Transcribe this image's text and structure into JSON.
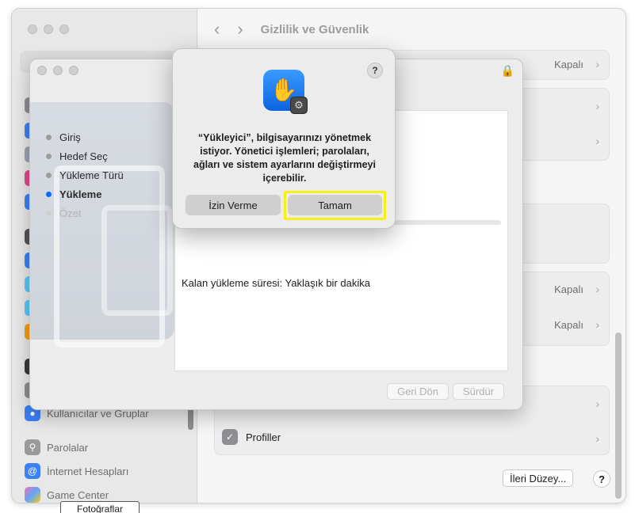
{
  "settings": {
    "title": "Gizlilik ve Güvenlik",
    "rows": [
      {
        "status": "Kapalı"
      },
      {
        "status": "Kapalı"
      },
      {
        "status": "Kapalı"
      }
    ],
    "profiles_label": "Profiller",
    "advanced_button": "İleri Düzey...",
    "help": "?"
  },
  "sidebar": {
    "items": [
      {
        "label": "Kullanıcılar ve Gruplar",
        "icon": "users-icon"
      },
      {
        "label": "Parolalar",
        "icon": "key-icon"
      },
      {
        "label": "İnternet Hesapları",
        "icon": "at-icon"
      },
      {
        "label": "Game Center",
        "icon": "game-center-icon"
      }
    ],
    "tooltip": "Fotoğraflar"
  },
  "installer": {
    "steps": [
      {
        "label": "Giriş",
        "state": "done"
      },
      {
        "label": "Hedef Seç",
        "state": "done"
      },
      {
        "label": "Yükleme Türü",
        "state": "done"
      },
      {
        "label": "Yükleme",
        "state": "active"
      },
      {
        "label": "Özet",
        "state": "disabled"
      }
    ],
    "remaining": "Kalan yükleme süresi: Yaklaşık bir dakika",
    "back_button": "Geri Dön",
    "continue_button": "Sürdür"
  },
  "alert": {
    "message": "“Yükleyici”, bilgisayarınızı yönetmek istiyor. Yönetici işlemleri; parolaları, ağları ve sistem ayarlarını değiştirmeyi içerebilir.",
    "deny_button": "İzin Verme",
    "ok_button": "Tamam",
    "help": "?"
  },
  "colors": {
    "accent": "#0a6cff",
    "highlight": "#f6ef18"
  }
}
